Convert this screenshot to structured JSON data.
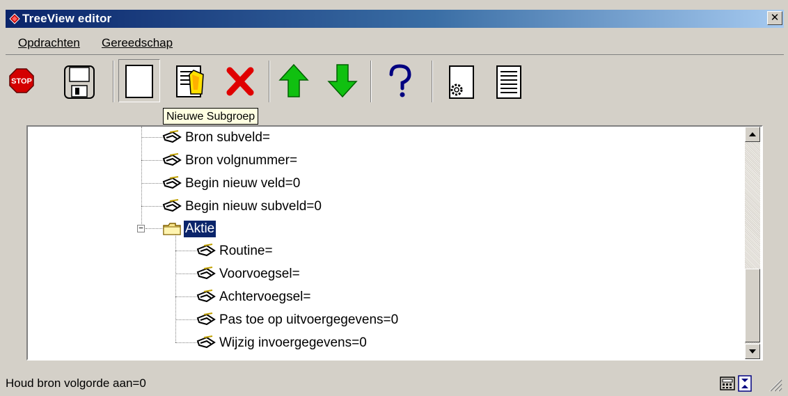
{
  "window": {
    "title": "TreeView editor",
    "close_glyph": "✕"
  },
  "menu": [
    {
      "label": "Opdrachten"
    },
    {
      "label": "Gereedschap"
    }
  ],
  "toolbar": {
    "buttons": [
      {
        "name": "stop-button",
        "icon": "stop-sign-icon",
        "label": "STOP"
      },
      {
        "name": "save-button",
        "icon": "floppy-disk-icon"
      },
      {
        "name": "new-subgroup-button",
        "icon": "blank-page-icon",
        "pressed": true
      },
      {
        "name": "edit-button",
        "icon": "edit-document-icon"
      },
      {
        "name": "delete-button",
        "icon": "red-x-icon"
      },
      {
        "name": "move-up-button",
        "icon": "green-up-arrow-icon"
      },
      {
        "name": "move-down-button",
        "icon": "green-down-arrow-icon"
      },
      {
        "name": "help-button",
        "icon": "question-mark-icon"
      },
      {
        "name": "settings-button",
        "icon": "gear-document-icon"
      },
      {
        "name": "list-button",
        "icon": "list-document-icon"
      }
    ]
  },
  "tooltip": {
    "text": "Nieuwe Subgroep"
  },
  "tree": {
    "items": [
      {
        "label": "Bron subveld=",
        "type": "property",
        "level": 1
      },
      {
        "label": "Bron volgnummer=",
        "type": "property",
        "level": 1
      },
      {
        "label": "Begin nieuw veld=0",
        "type": "property",
        "level": 1
      },
      {
        "label": "Begin nieuw subveld=0",
        "type": "property",
        "level": 1
      },
      {
        "label": "Aktie",
        "type": "folder",
        "level": 0,
        "expanded": true,
        "selected": true
      },
      {
        "label": "Routine=",
        "type": "property",
        "level": 2
      },
      {
        "label": "Voorvoegsel=",
        "type": "property",
        "level": 2
      },
      {
        "label": "Achtervoegsel=",
        "type": "property",
        "level": 2
      },
      {
        "label": "Pas toe op uitvoergegevens=0",
        "type": "property",
        "level": 2
      },
      {
        "label": "Wijzig invoergegevens=0",
        "type": "property",
        "level": 2
      }
    ],
    "expander_glyph": "−"
  },
  "status": {
    "text": "Houd bron volgorde aan=0",
    "icons": [
      "calculator-icon",
      "expand-icon",
      "resize-grip-icon"
    ]
  },
  "colors": {
    "title_gradient_start": "#0a246a",
    "title_gradient_end": "#a6caf0",
    "selection": "#0a246a",
    "face": "#d4d0c8",
    "tooltip_bg": "#ffffe1"
  }
}
